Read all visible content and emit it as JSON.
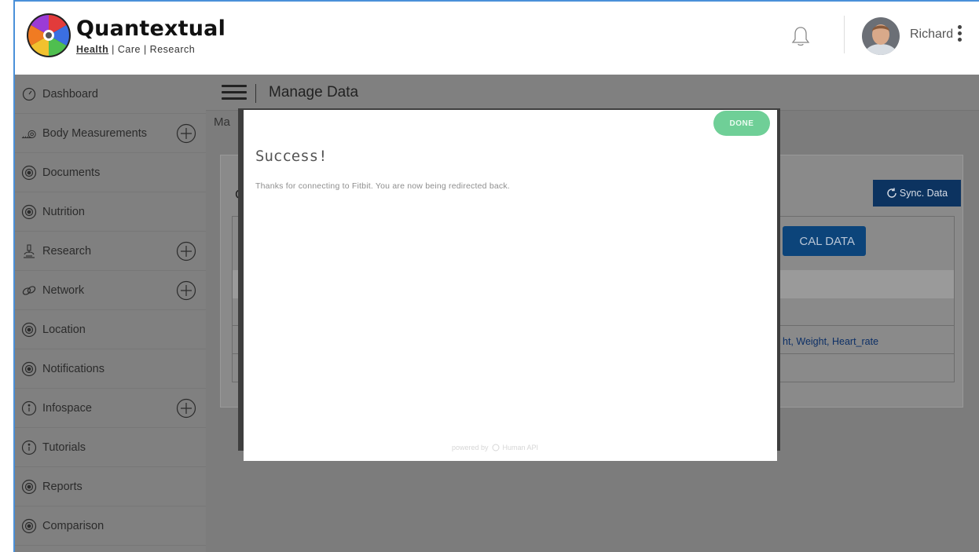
{
  "header": {
    "brand_name": "Quantextual",
    "tag_health": "Health",
    "tag_rest": " | Care | Research",
    "user_name": "Richard"
  },
  "sidebar": {
    "items": [
      {
        "label": "Dashboard",
        "icon": "dashboard-gauge-icon",
        "has_plus": false
      },
      {
        "label": "Body Measurements",
        "icon": "tape-measure-icon",
        "has_plus": true
      },
      {
        "label": "Documents",
        "icon": "circle-dot-icon",
        "has_plus": false
      },
      {
        "label": "Nutrition",
        "icon": "circle-dot-icon",
        "has_plus": false
      },
      {
        "label": "Research",
        "icon": "microscope-icon",
        "has_plus": true
      },
      {
        "label": "Network",
        "icon": "link-icon",
        "has_plus": true
      },
      {
        "label": "Location",
        "icon": "circle-dot-icon",
        "has_plus": false
      },
      {
        "label": "Notifications",
        "icon": "circle-dot-icon",
        "has_plus": false
      },
      {
        "label": "Infospace",
        "icon": "info-icon",
        "has_plus": true
      },
      {
        "label": "Tutorials",
        "icon": "info-icon",
        "has_plus": false
      },
      {
        "label": "Reports",
        "icon": "circle-dot-icon",
        "has_plus": false
      },
      {
        "label": "Comparison",
        "icon": "circle-dot-icon",
        "has_plus": false
      }
    ]
  },
  "main": {
    "page_title": "Manage Data",
    "breadcrumb": "Ma",
    "panel_letter": "C",
    "sync_label": "Sync. Data",
    "local_data_label": "CAL DATA",
    "row_text": "ht, Weight, Heart_rate"
  },
  "modal": {
    "done_label": "DONE",
    "title": "Success!",
    "message": "Thanks for connecting to Fitbit. You are now being redirected back.",
    "powered_by": "powered by",
    "powered_brand": "Human API"
  },
  "colors": {
    "accent_blue": "#0c3360",
    "done_green": "#6fcf97",
    "overlay_gray": "#7c7c7c"
  }
}
